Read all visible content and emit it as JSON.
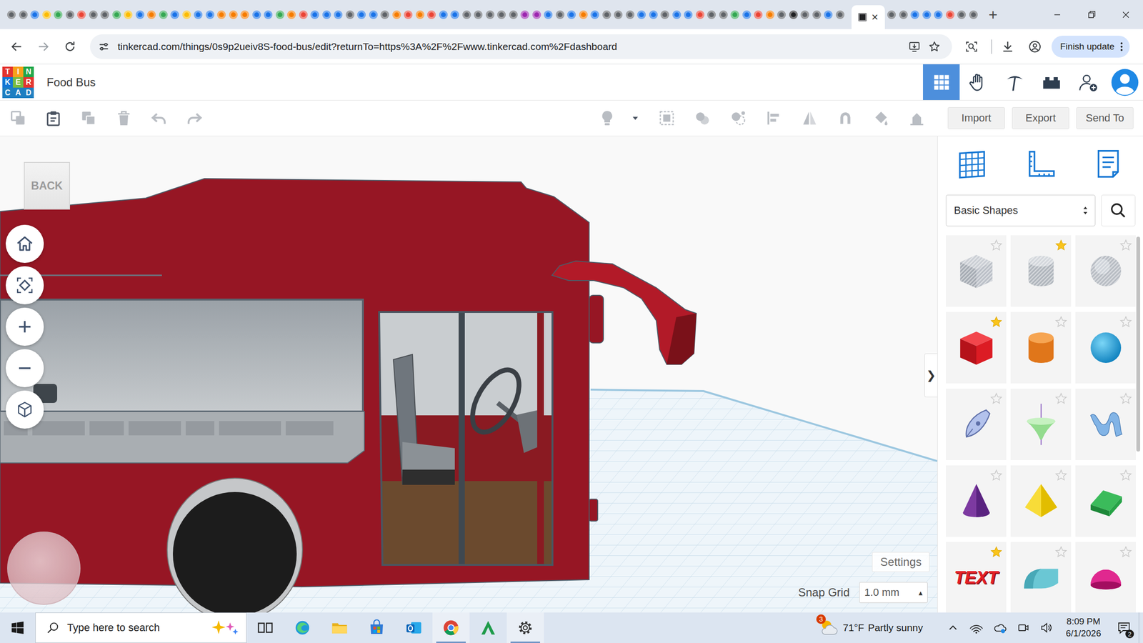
{
  "browser": {
    "tabs": [
      {
        "selected": false,
        "color": "#5f6368"
      },
      {
        "selected": false,
        "color": "#5f6368"
      },
      {
        "selected": false,
        "color": "#1a73e8"
      },
      {
        "selected": false,
        "color": "#fbbc04"
      },
      {
        "selected": false,
        "color": "#34a853"
      },
      {
        "selected": false,
        "color": "#5f6368"
      },
      {
        "selected": false,
        "color": "#ea4335"
      },
      {
        "selected": false,
        "color": "#5f6368"
      },
      {
        "selected": false,
        "color": "#5f6368"
      },
      {
        "selected": false,
        "color": "#34a853"
      },
      {
        "selected": false,
        "color": "#fbbc04"
      },
      {
        "selected": false,
        "color": "#1a73e8"
      },
      {
        "selected": false,
        "color": "#f57c00"
      },
      {
        "selected": false,
        "color": "#34a853"
      },
      {
        "selected": false,
        "color": "#1a73e8"
      },
      {
        "selected": false,
        "color": "#fbbc04"
      },
      {
        "selected": false,
        "color": "#1a73e8"
      },
      {
        "selected": false,
        "color": "#1a73e8"
      },
      {
        "selected": false,
        "color": "#f57c00"
      },
      {
        "selected": false,
        "color": "#f57c00"
      },
      {
        "selected": false,
        "color": "#f57c00"
      },
      {
        "selected": false,
        "color": "#1a73e8"
      },
      {
        "selected": false,
        "color": "#1a73e8"
      },
      {
        "selected": false,
        "color": "#34a853"
      },
      {
        "selected": false,
        "color": "#f57c00"
      },
      {
        "selected": false,
        "color": "#ea4335"
      },
      {
        "selected": false,
        "color": "#1a73e8"
      },
      {
        "selected": false,
        "color": "#1a73e8"
      },
      {
        "selected": false,
        "color": "#1a73e8"
      },
      {
        "selected": false,
        "color": "#5f6368"
      },
      {
        "selected": false,
        "color": "#1a73e8"
      },
      {
        "selected": false,
        "color": "#1a73e8"
      },
      {
        "selected": false,
        "color": "#5f6368"
      },
      {
        "selected": false,
        "color": "#f57c00"
      },
      {
        "selected": false,
        "color": "#ea4335"
      },
      {
        "selected": false,
        "color": "#f57c00"
      },
      {
        "selected": false,
        "color": "#ea4335"
      },
      {
        "selected": false,
        "color": "#1a73e8"
      },
      {
        "selected": false,
        "color": "#1a73e8"
      },
      {
        "selected": false,
        "color": "#5f6368"
      },
      {
        "selected": false,
        "color": "#5f6368"
      },
      {
        "selected": false,
        "color": "#5f6368"
      },
      {
        "selected": false,
        "color": "#5f6368"
      },
      {
        "selected": false,
        "color": "#5f6368"
      },
      {
        "selected": false,
        "color": "#9c27b0"
      },
      {
        "selected": false,
        "color": "#9c27b0"
      },
      {
        "selected": false,
        "color": "#1a73e8"
      },
      {
        "selected": false,
        "color": "#5f6368"
      },
      {
        "selected": false,
        "color": "#1a73e8"
      },
      {
        "selected": false,
        "color": "#f57c00"
      },
      {
        "selected": false,
        "color": "#1a73e8"
      },
      {
        "selected": false,
        "color": "#5f6368"
      },
      {
        "selected": false,
        "color": "#5f6368"
      },
      {
        "selected": false,
        "color": "#5f6368"
      },
      {
        "selected": false,
        "color": "#1a73e8"
      },
      {
        "selected": false,
        "color": "#1a73e8"
      },
      {
        "selected": false,
        "color": "#5f6368"
      },
      {
        "selected": false,
        "color": "#1a73e8"
      },
      {
        "selected": false,
        "color": "#1a73e8"
      },
      {
        "selected": false,
        "color": "#ea4335"
      },
      {
        "selected": false,
        "color": "#5f6368"
      },
      {
        "selected": false,
        "color": "#5f6368"
      },
      {
        "selected": false,
        "color": "#34a853"
      },
      {
        "selected": false,
        "color": "#1a73e8"
      },
      {
        "selected": false,
        "color": "#ea4335"
      },
      {
        "selected": false,
        "color": "#f57c00"
      },
      {
        "selected": false,
        "color": "#5f6368"
      },
      {
        "selected": false,
        "color": "#202124"
      },
      {
        "selected": false,
        "color": "#5f6368"
      },
      {
        "selected": false,
        "color": "#5f6368"
      },
      {
        "selected": false,
        "color": "#1a73e8"
      },
      {
        "selected": false,
        "color": "#5f6368"
      },
      {
        "selected": true,
        "color": "#202124",
        "close": "×"
      },
      {
        "selected": false,
        "color": "#5f6368"
      },
      {
        "selected": false,
        "color": "#5f6368"
      },
      {
        "selected": false,
        "color": "#1a73e8"
      },
      {
        "selected": false,
        "color": "#1a73e8"
      },
      {
        "selected": false,
        "color": "#1a73e8"
      },
      {
        "selected": false,
        "color": "#ea4335"
      },
      {
        "selected": false,
        "color": "#5f6368"
      },
      {
        "selected": false,
        "color": "#5f6368"
      }
    ],
    "new_tab": "+",
    "url": "tinkercad.com/things/0s9p2ueiv8S-food-bus/edit?returnTo=https%3A%2F%2Fwww.tinkercad.com%2Fdashboard",
    "finish_update": "Finish update"
  },
  "app": {
    "logo": [
      {
        "letter": "T",
        "color": "#e3342f"
      },
      {
        "letter": "I",
        "color": "#f7a11a"
      },
      {
        "letter": "N",
        "color": "#1fa64a"
      },
      {
        "letter": "K",
        "color": "#1477d4"
      },
      {
        "letter": "E",
        "color": "#79bb3f"
      },
      {
        "letter": "R",
        "color": "#e3342f"
      },
      {
        "letter": "C",
        "color": "#1e7fc1"
      },
      {
        "letter": "A",
        "color": "#1e7fc1"
      },
      {
        "letter": "D",
        "color": "#1e7fc1"
      }
    ],
    "title": "Food Bus",
    "nav": [
      {
        "selected": true
      },
      {
        "selected": false
      },
      {
        "selected": false
      },
      {
        "selected": false
      },
      {
        "selected": false
      },
      {
        "selected": false
      }
    ]
  },
  "toolbar": {
    "left": [
      {
        "enabled": false
      },
      {
        "enabled": true
      },
      {
        "enabled": false
      },
      {
        "enabled": false
      },
      {
        "enabled": false
      },
      {
        "enabled": false
      }
    ],
    "right": [
      {
        "enabled": false
      },
      {
        "enabled": true
      },
      {
        "enabled": false
      },
      {
        "enabled": false
      },
      {
        "enabled": false
      },
      {
        "enabled": false
      },
      {
        "enabled": false
      },
      {
        "enabled": false
      },
      {
        "enabled": false
      },
      {
        "enabled": false
      }
    ],
    "buttons": [
      "Import",
      "Export",
      "Send To"
    ]
  },
  "workspace": {
    "view_cube": "BACK",
    "collapse": "❯",
    "settings": "Settings",
    "snap_grid": {
      "label": "Snap Grid",
      "value": "1.0 mm",
      "arrow": "▴"
    }
  },
  "panel": {
    "category": "Basic Shapes",
    "tiles": [
      {
        "starred": false
      },
      {
        "starred": true
      },
      {
        "starred": false
      },
      {
        "starred": true
      },
      {
        "starred": false
      },
      {
        "starred": false
      },
      {
        "starred": false
      },
      {
        "starred": false
      },
      {
        "starred": false
      },
      {
        "starred": false
      },
      {
        "starred": false
      },
      {
        "starred": false
      },
      {
        "starred": true,
        "text": "TEXT"
      },
      {
        "starred": false
      },
      {
        "starred": false
      }
    ]
  },
  "taskbar": {
    "search_placeholder": "Type here to search",
    "apps": [
      {
        "active": false
      },
      {
        "active": false
      },
      {
        "active": false
      },
      {
        "active": false
      },
      {
        "active": false
      },
      {
        "active": true
      },
      {
        "active": false
      },
      {
        "active": true
      }
    ],
    "weather": {
      "temp": "71°F",
      "summary": "Partly sunny",
      "badge": "3"
    },
    "clock": {
      "time": "8:09 PM",
      "date": "6/1/2026"
    },
    "notifications": "2"
  }
}
